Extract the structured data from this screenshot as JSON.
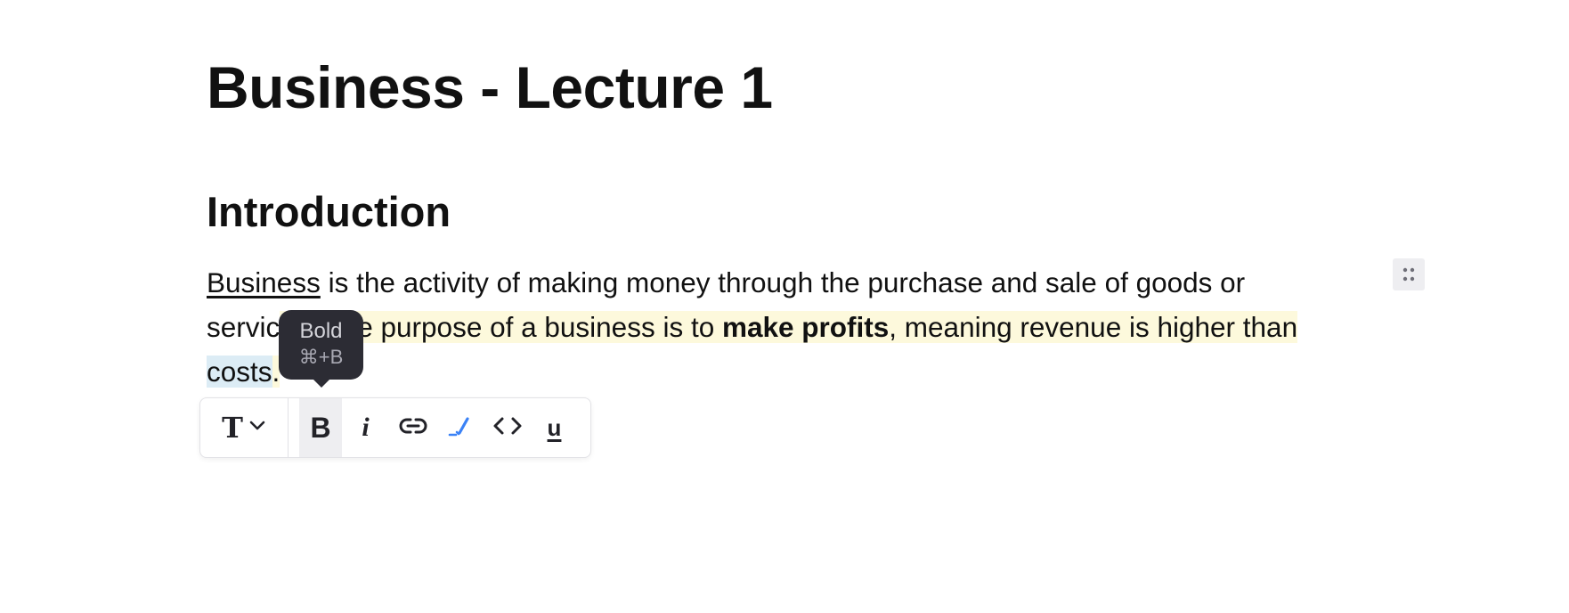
{
  "document": {
    "title": "Business - Lecture 1",
    "section_heading": "Introduction",
    "paragraph": {
      "link_word": "Business",
      "text_1": " is the activity of making money through the purchase and sale of goods or servic",
      "text_hl": "es. The purpose of a business is to ",
      "bold_text": "make profits",
      "text_hl_2": ", meaning revenue is higher than ",
      "text_selected": "costs",
      "text_end": "."
    }
  },
  "tooltip": {
    "label": "Bold",
    "shortcut": "⌘+B"
  },
  "toolbar": {
    "text_type_glyph": "T",
    "bold_glyph": "B",
    "italic_glyph": "i",
    "underline_glyph": "u",
    "icons": [
      "text-type-icon",
      "chevron-down-icon",
      "bold-icon",
      "italic-icon",
      "link-icon",
      "highlight-icon",
      "code-icon",
      "underline-icon"
    ]
  },
  "colors": {
    "highlight": "#fdf9dc",
    "selection": "#dcecf5",
    "tooltip_bg": "#2c2c34",
    "highlight_icon": "#3b82f6",
    "active_button_bg": "#eeeef1"
  }
}
